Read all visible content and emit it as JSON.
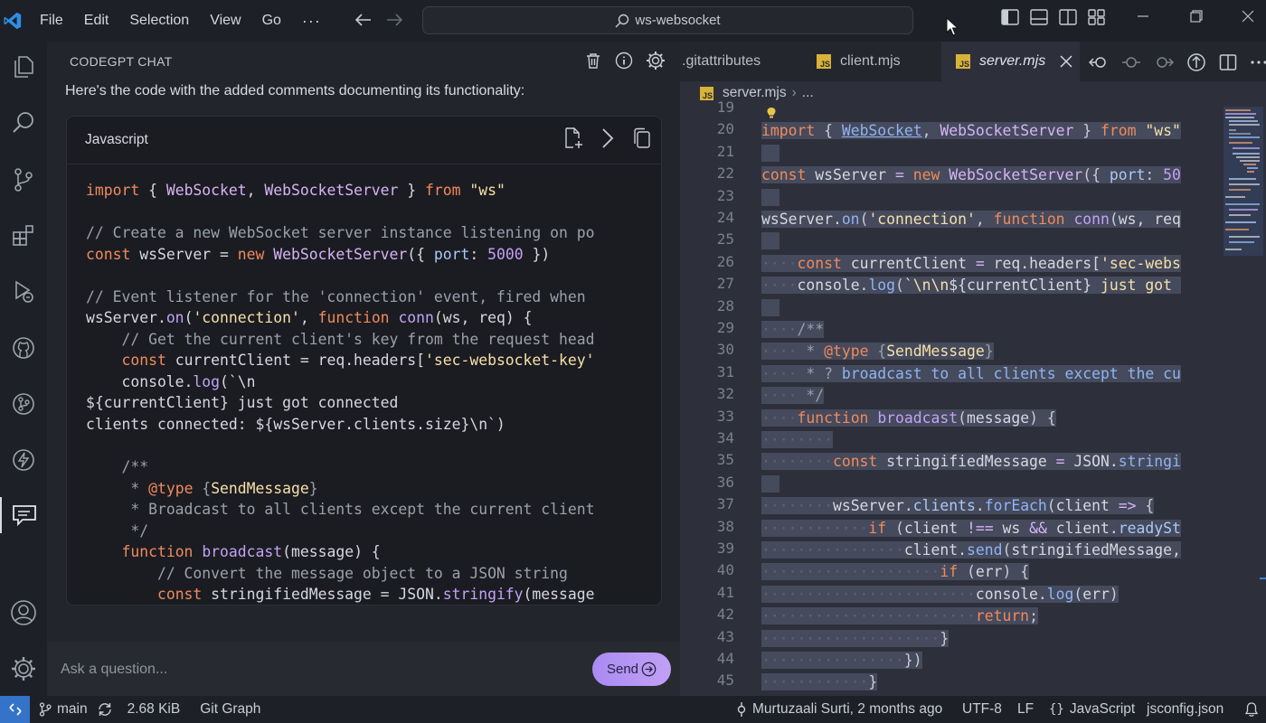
{
  "titlebar": {
    "menu": [
      "File",
      "Edit",
      "Selection",
      "View",
      "Go"
    ],
    "more": "···",
    "search": "ws-websocket"
  },
  "chat": {
    "title": "CODEGPT CHAT",
    "intro": "Here's the code with the added comments documenting its functionality:",
    "code_language": "Javascript",
    "code_lines": [
      [
        [
          "kw",
          "import"
        ],
        [
          "tx",
          " { "
        ],
        [
          "cls",
          "WebSocket"
        ],
        [
          "tx",
          ", "
        ],
        [
          "cls",
          "WebSocketServer"
        ],
        [
          "tx",
          " } "
        ],
        [
          "kw",
          "from"
        ],
        [
          "tx",
          " "
        ],
        [
          "str",
          "\"ws\""
        ]
      ],
      [],
      [
        [
          "cm",
          "// Create a new WebSocket server instance listening on po"
        ]
      ],
      [
        [
          "kw",
          "const"
        ],
        [
          "tx",
          " wsServer = "
        ],
        [
          "kw",
          "new"
        ],
        [
          "tx",
          " "
        ],
        [
          "cls",
          "WebSocketServer"
        ],
        [
          "tx",
          "({ "
        ],
        [
          "prop",
          "port"
        ],
        [
          "tx",
          ": "
        ],
        [
          "num",
          "5000"
        ],
        [
          "tx",
          " })"
        ]
      ],
      [],
      [
        [
          "cm",
          "// Event listener for the 'connection' event, fired when"
        ]
      ],
      [
        [
          "tx",
          "wsServer."
        ],
        [
          "fn",
          "on"
        ],
        [
          "tx",
          "("
        ],
        [
          "str",
          "'connection'"
        ],
        [
          "tx",
          ", "
        ],
        [
          "kw",
          "function"
        ],
        [
          "tx",
          " "
        ],
        [
          "fn",
          "conn"
        ],
        [
          "tx",
          "(ws, req) {"
        ]
      ],
      [
        [
          "tx",
          "    "
        ],
        [
          "cm",
          "// Get the current client's key from the request head"
        ]
      ],
      [
        [
          "tx",
          "    "
        ],
        [
          "kw",
          "const"
        ],
        [
          "tx",
          " currentClient = req.headers["
        ],
        [
          "str",
          "'sec-websocket-key'"
        ]
      ],
      [
        [
          "tx",
          "    console."
        ],
        [
          "fn",
          "log"
        ],
        [
          "tx",
          "(`\\n"
        ]
      ],
      [
        [
          "tx",
          "${currentClient} just got connected"
        ]
      ],
      [
        [
          "tx",
          "clients connected: ${wsServer.clients.size}\\n`)"
        ]
      ],
      [],
      [
        [
          "tx",
          "    "
        ],
        [
          "cm",
          "/**"
        ]
      ],
      [
        [
          "tx",
          "     "
        ],
        [
          "cm",
          "* "
        ],
        [
          "tag",
          "@type"
        ],
        [
          "cm",
          " {"
        ],
        [
          "ty",
          "SendMessage"
        ],
        [
          "cm",
          "}"
        ]
      ],
      [
        [
          "tx",
          "     "
        ],
        [
          "cm",
          "* Broadcast to all clients except the current client"
        ]
      ],
      [
        [
          "tx",
          "     "
        ],
        [
          "cm",
          "*/"
        ]
      ],
      [
        [
          "tx",
          "    "
        ],
        [
          "kw",
          "function"
        ],
        [
          "tx",
          " "
        ],
        [
          "fn",
          "broadcast"
        ],
        [
          "tx",
          "(message) {"
        ]
      ],
      [
        [
          "tx",
          "        "
        ],
        [
          "cm",
          "// Convert the message object to a JSON string"
        ]
      ],
      [
        [
          "tx",
          "        "
        ],
        [
          "kw",
          "const"
        ],
        [
          "tx",
          " stringifiedMessage = JSON."
        ],
        [
          "fn",
          "stringify"
        ],
        [
          "tx",
          "(message"
        ]
      ]
    ],
    "input_placeholder": "Ask a question...",
    "send_label": "Send"
  },
  "editor": {
    "tabs": [
      {
        "label": ".gitattributes",
        "active": false
      },
      {
        "label": "client.mjs",
        "active": false
      },
      {
        "label": "server.mjs",
        "active": true
      }
    ],
    "breadcrumb_file": "server.mjs",
    "breadcrumb_more": "...",
    "line_numbers": [
      "19",
      "20",
      "21",
      "22",
      "23",
      "24",
      "25",
      "26",
      "27",
      "28",
      "29",
      "30",
      "31",
      "32",
      "33",
      "34",
      "35",
      "36",
      "37",
      "38",
      "39",
      "40",
      "41",
      "42",
      "43",
      "44",
      "45"
    ],
    "code_lines": [
      {
        "indent": "",
        "tokens": []
      },
      {
        "indent": "",
        "tokens": [
          [
            "kw",
            "import"
          ],
          [
            "pn",
            " { "
          ],
          [
            "link",
            "WebSocket"
          ],
          [
            "pn",
            ", "
          ],
          [
            "cls",
            "WebSocketServer"
          ],
          [
            "pn",
            " } "
          ],
          [
            "kw",
            "from"
          ],
          [
            "pn",
            " "
          ],
          [
            "str",
            "\"ws\""
          ]
        ]
      },
      {
        "indent": "",
        "tokens": []
      },
      {
        "indent": "",
        "tokens": [
          [
            "kw",
            "const"
          ],
          [
            "tx",
            " wsServer "
          ],
          [
            "op",
            "="
          ],
          [
            "tx",
            " "
          ],
          [
            "kw",
            "new"
          ],
          [
            "tx",
            " "
          ],
          [
            "cls",
            "WebSocketServer"
          ],
          [
            "pn",
            "({ "
          ],
          [
            "prop",
            "port"
          ],
          [
            "pn",
            ": "
          ],
          [
            "num",
            "50"
          ]
        ]
      },
      {
        "indent": "",
        "tokens": []
      },
      {
        "indent": "",
        "tokens": [
          [
            "tx",
            "wsServer."
          ],
          [
            "blue",
            "on"
          ],
          [
            "pn",
            "("
          ],
          [
            "str",
            "'connection'"
          ],
          [
            "pn",
            ", "
          ],
          [
            "kw",
            "function"
          ],
          [
            "tx",
            " "
          ],
          [
            "fn",
            "conn"
          ],
          [
            "pn",
            "("
          ],
          [
            "tx",
            "ws, req"
          ]
        ]
      },
      {
        "indent": "",
        "tokens": []
      },
      {
        "indent": "····",
        "tokens": [
          [
            "kw",
            "const"
          ],
          [
            "tx",
            " currentClient "
          ],
          [
            "op",
            "="
          ],
          [
            "tx",
            " req.headers["
          ],
          [
            "str",
            "'sec-webs"
          ]
        ]
      },
      {
        "indent": "····",
        "tokens": [
          [
            "tx",
            "console."
          ],
          [
            "blue",
            "log"
          ],
          [
            "pn",
            "("
          ],
          [
            "str",
            "`\\n\\n"
          ],
          [
            "tx",
            "${currentClient}"
          ],
          [
            "str",
            " just got "
          ]
        ]
      },
      {
        "indent": "",
        "tokens": []
      },
      {
        "indent": "····",
        "tokens": [
          [
            "cm",
            "/**"
          ]
        ]
      },
      {
        "indent": "····",
        "tokens": [
          [
            "cm",
            " * "
          ],
          [
            "tag",
            "@type"
          ],
          [
            "cm",
            " {"
          ],
          [
            "ty",
            "SendMessage"
          ],
          [
            "cm",
            "}"
          ]
        ]
      },
      {
        "indent": "····",
        "tokens": [
          [
            "cm",
            " * ? "
          ],
          [
            "blue",
            "broadcast to all clients except the cu"
          ]
        ]
      },
      {
        "indent": "····",
        "tokens": [
          [
            "cm",
            " */"
          ]
        ]
      },
      {
        "indent": "····",
        "tokens": [
          [
            "kw",
            "function"
          ],
          [
            "tx",
            " "
          ],
          [
            "fn",
            "broadcast"
          ],
          [
            "pn",
            "("
          ],
          [
            "tx",
            "message"
          ],
          [
            "pn",
            ") {"
          ]
        ]
      },
      {
        "indent": "········",
        "tokens": []
      },
      {
        "indent": "········",
        "tokens": [
          [
            "kw",
            "const"
          ],
          [
            "tx",
            " stringifiedMessage "
          ],
          [
            "op",
            "="
          ],
          [
            "tx",
            " JSON."
          ],
          [
            "blue",
            "stringi"
          ]
        ]
      },
      {
        "indent": "",
        "tokens": []
      },
      {
        "indent": "········",
        "tokens": [
          [
            "tx",
            "wsServer."
          ],
          [
            "prop",
            "clients"
          ],
          [
            "tx",
            "."
          ],
          [
            "blue",
            "forEach"
          ],
          [
            "pn",
            "("
          ],
          [
            "tx",
            "client "
          ],
          [
            "op",
            "=>"
          ],
          [
            "pn",
            " {"
          ]
        ]
      },
      {
        "indent": "············",
        "tokens": [
          [
            "kw",
            "if"
          ],
          [
            "pn",
            " ("
          ],
          [
            "tx",
            "client "
          ],
          [
            "op",
            "!=="
          ],
          [
            "tx",
            " ws "
          ],
          [
            "op",
            "&&"
          ],
          [
            "tx",
            " client."
          ],
          [
            "prop",
            "readySt"
          ]
        ]
      },
      {
        "indent": "················",
        "tokens": [
          [
            "tx",
            "client."
          ],
          [
            "blue",
            "send"
          ],
          [
            "pn",
            "("
          ],
          [
            "tx",
            "stringifiedMessage,"
          ]
        ]
      },
      {
        "indent": "····················",
        "tokens": [
          [
            "kw",
            "if"
          ],
          [
            "pn",
            " ("
          ],
          [
            "tx",
            "err"
          ],
          [
            "pn",
            ") {"
          ]
        ]
      },
      {
        "indent": "························",
        "tokens": [
          [
            "tx",
            "console."
          ],
          [
            "blue",
            "log"
          ],
          [
            "pn",
            "("
          ],
          [
            "tx",
            "err"
          ],
          [
            "pn",
            ")"
          ]
        ]
      },
      {
        "indent": "························",
        "tokens": [
          [
            "kw",
            "return"
          ],
          [
            "pn",
            ";"
          ]
        ]
      },
      {
        "indent": "····················",
        "tokens": [
          [
            "pn",
            "}"
          ]
        ]
      },
      {
        "indent": "················",
        "tokens": [
          [
            "pn",
            "})"
          ]
        ]
      },
      {
        "indent": "············",
        "tokens": [
          [
            "pn",
            "}"
          ]
        ]
      }
    ]
  },
  "statusbar": {
    "branch": "main",
    "size": "2.68 KiB",
    "git_graph": "Git Graph",
    "blame": "Murtuzaali Surti, 2 months ago",
    "encoding": "UTF-8",
    "eol": "LF",
    "language": "JavaScript",
    "config": "jsconfig.json"
  },
  "colors": {
    "accent": "#3473c7",
    "send_button": "#b597f4",
    "js_badge": "#d9b23a"
  },
  "icons": [
    "vscode-logo-icon",
    "explorer-icon",
    "search-icon",
    "source-control-icon",
    "extensions-icon",
    "run-debug-icon",
    "github-icon",
    "git-graph-icon",
    "lightning-icon",
    "chat-icon",
    "account-icon",
    "settings-icon",
    "trash-icon",
    "info-icon",
    "gear-icon",
    "new-file-icon",
    "insert-icon",
    "copy-icon",
    "close-icon",
    "split-editor-icon",
    "lightbulb-icon"
  ]
}
